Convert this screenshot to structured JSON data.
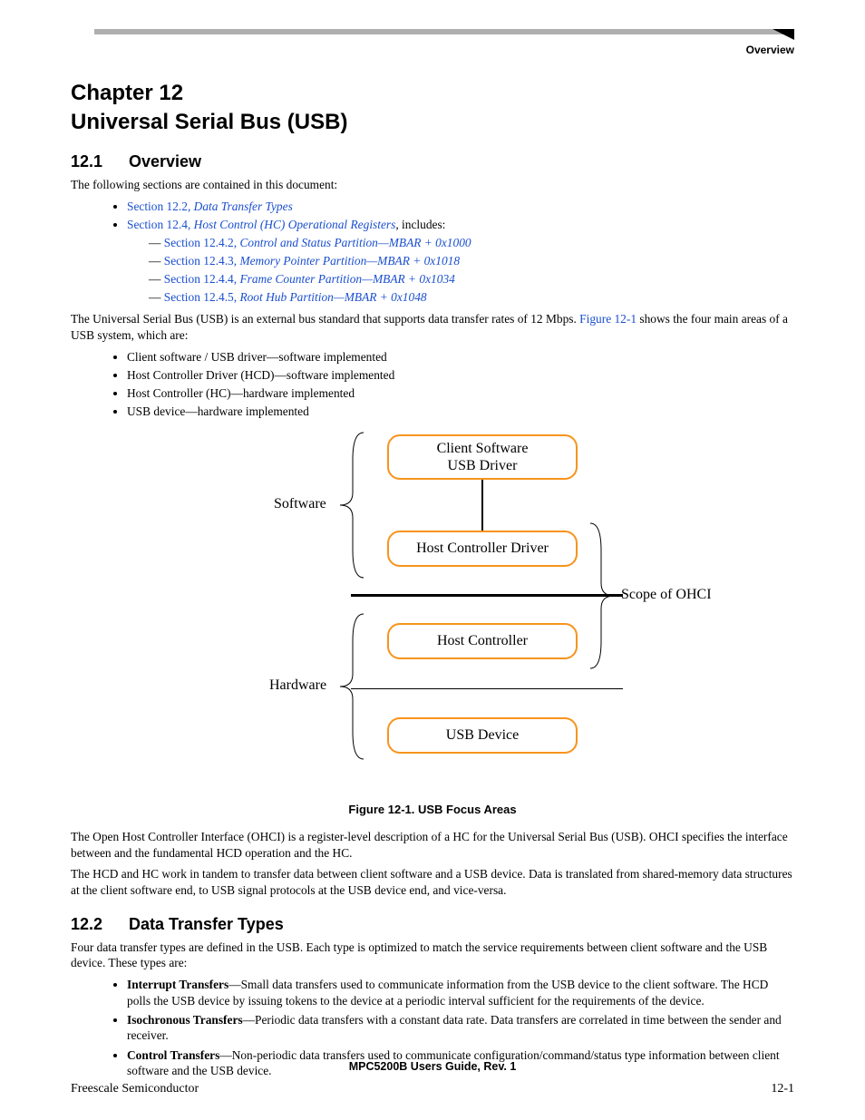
{
  "header": {
    "corner": "Overview"
  },
  "chapter": {
    "line1": "Chapter 12",
    "line2": "Universal Serial Bus (USB)"
  },
  "sec_overview": {
    "num": "12.1",
    "title": "Overview",
    "intro": "The following sections are contained in this document:",
    "links": {
      "l1_pre": "Section 12.2, ",
      "l1_it": "Data Transfer Types",
      "l2_pre": "Section 12.4, ",
      "l2_it": "Host Control (HC) Operational Registers",
      "l2_post": ", includes:",
      "s1_pre": "Section 12.4.2, ",
      "s1_it": "Control and Status Partition—MBAR + 0x1000",
      "s2_pre": "Section 12.4.3, ",
      "s2_it": "Memory Pointer Partition—MBAR + 0x1018",
      "s3_pre": "Section 12.4.4, ",
      "s3_it": "Frame Counter Partition—MBAR + 0x1034",
      "s4_pre": "Section 12.4.5, ",
      "s4_it": "Root Hub Partition—MBAR + 0x1048"
    },
    "para2_a": "The Universal Serial Bus (USB) is an external bus standard that supports data transfer rates of 12 Mbps. ",
    "para2_link": "Figure 12-1",
    "para2_b": " shows the four main areas of a USB system, which are:",
    "areas": [
      "Client software / USB driver—software implemented",
      "Host Controller Driver (HCD)—software implemented",
      "Host Controller (HC)—hardware implemented",
      "USB device—hardware implemented"
    ],
    "para3": "The Open Host Controller Interface (OHCI) is a register-level description of a HC for the Universal Serial Bus (USB). OHCI specifies the interface between and the fundamental HCD operation and the HC.",
    "para4": "The HCD and HC work in tandem to transfer data between client software and a USB device. Data is translated from shared-memory data structures at the client software end, to USB signal protocols at the USB device end, and vice-versa."
  },
  "diagram": {
    "box1a": "Client Software",
    "box1b": "USB Driver",
    "box2": "Host Controller Driver",
    "box3": "Host Controller",
    "box4": "USB Device",
    "left1": "Software",
    "left2": "Hardware",
    "right": "Scope of OHCI",
    "caption": "Figure 12-1. USB Focus Areas"
  },
  "sec_transfer": {
    "num": "12.2",
    "title": "Data Transfer Types",
    "intro": "Four data transfer types are defined in the USB. Each type is optimized to match the service requirements between client software and the USB device. These types are:",
    "items": [
      {
        "name": "Interrupt Transfers",
        "desc": "—Small data transfers used to communicate information from the USB device to the client software. The HCD polls the USB device by issuing tokens to the device at a periodic interval sufficient for the requirements of the device."
      },
      {
        "name": "Isochronous Transfers",
        "desc": "—Periodic data transfers with a constant data rate. Data transfers are correlated in time between the sender and receiver."
      },
      {
        "name": "Control Transfers",
        "desc": "—Non-periodic data transfers used to communicate configuration/command/status type information between client software and the USB device."
      }
    ]
  },
  "footer": {
    "center": "MPC5200B Users Guide, Rev. 1",
    "left": "Freescale Semiconductor",
    "right": "12-1"
  }
}
